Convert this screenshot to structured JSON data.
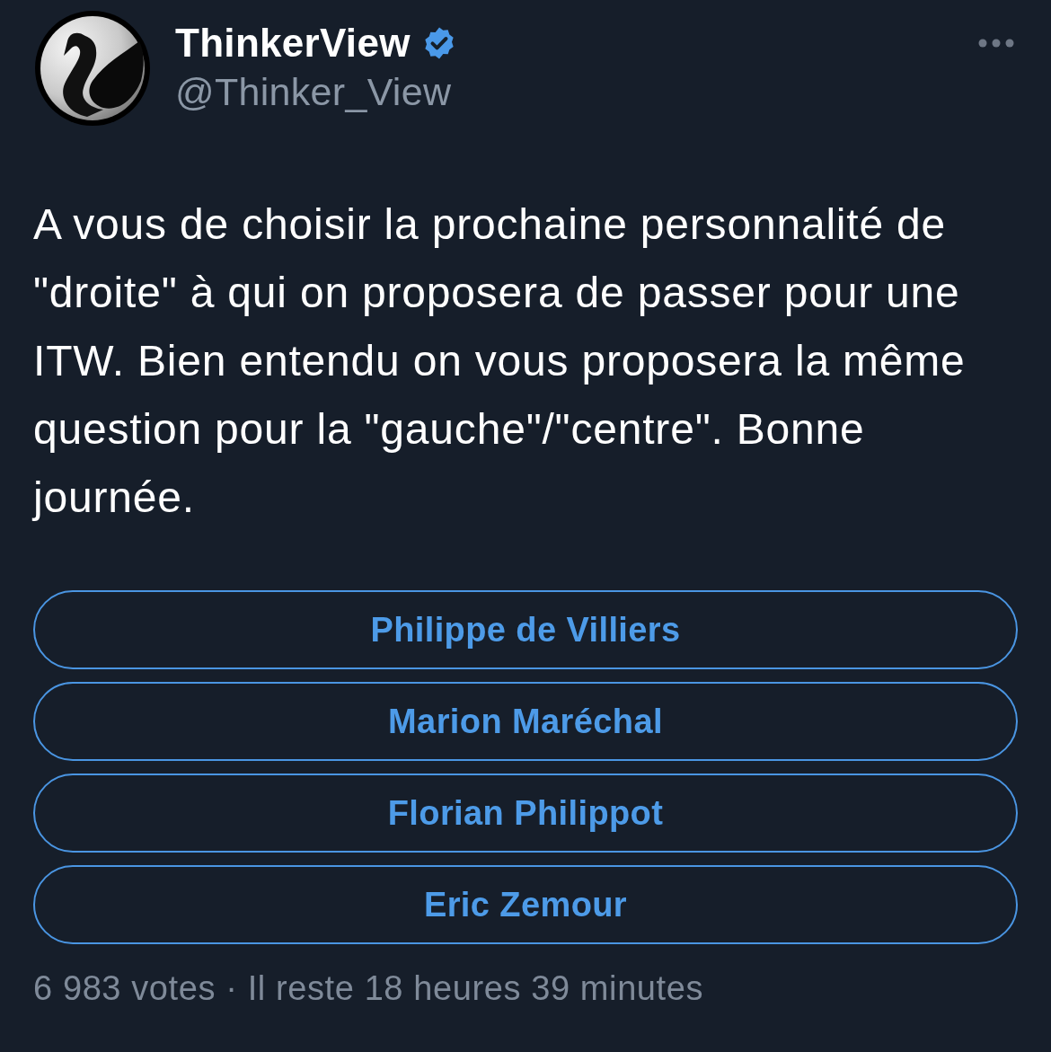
{
  "author": {
    "name": "ThinkerView",
    "verified": true,
    "handle": "@Thinker_View"
  },
  "tweet": {
    "text": "A vous de choisir la prochaine personnalité de \"droite\" à qui on proposera de passer pour une ITW. Bien entendu on vous proposera la même question pour la \"gauche\"/\"centre\". Bonne journée."
  },
  "poll": {
    "options": [
      {
        "label": "Philippe de Villiers"
      },
      {
        "label": "Marion Maréchal"
      },
      {
        "label": "Florian Philippot"
      },
      {
        "label": "Eric Zemour"
      }
    ],
    "footer": "6 983 votes · Il reste 18 heures 39 minutes"
  }
}
